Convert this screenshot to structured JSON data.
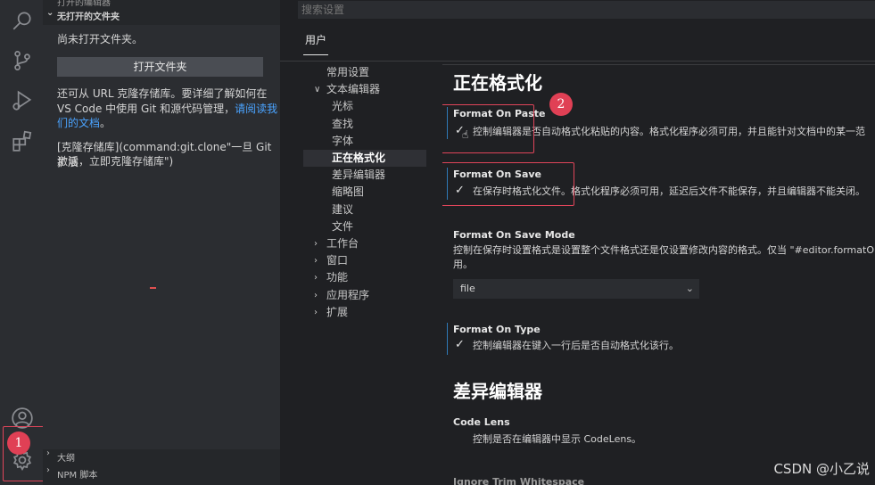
{
  "explorer": {
    "top_cut_label": "打开的编辑器",
    "section_title": "无打开的文件夹",
    "no_folder_text": "尚未打开文件夹。",
    "open_folder_button": "打开文件夹",
    "clone_text_1": "还可从 URL 克隆存储库。要详细了解如何在",
    "clone_text_2": "VS Code 中使用 Git 和源代码管理，",
    "clone_link_1": "请阅读我",
    "clone_link_2": "们的文档",
    "clone_text_end": "。",
    "clone_repo_1": "[克隆存储库](command:git.clone\"一旦 Git 扩展",
    "clone_repo_2": "激活，立即克隆存储库\")",
    "outline_label": "大纲",
    "npm_label": "NPM 脚本"
  },
  "settings": {
    "search_placeholder": "搜索设置",
    "tab_user": "用户",
    "toc": [
      {
        "label": "常用设置",
        "chev": ""
      },
      {
        "label": "文本编辑器",
        "chev": "∨"
      },
      {
        "label": "光标",
        "chev": ""
      },
      {
        "label": "查找",
        "chev": ""
      },
      {
        "label": "字体",
        "chev": ""
      },
      {
        "label": "正在格式化",
        "chev": "",
        "active": true
      },
      {
        "label": "差异编辑器",
        "chev": ""
      },
      {
        "label": "缩略图",
        "chev": ""
      },
      {
        "label": "建议",
        "chev": ""
      },
      {
        "label": "文件",
        "chev": ""
      },
      {
        "label": "工作台",
        "chev": ">"
      },
      {
        "label": "窗口",
        "chev": ">"
      },
      {
        "label": "功能",
        "chev": ">"
      },
      {
        "label": "应用程序",
        "chev": ">"
      },
      {
        "label": "扩展",
        "chev": ">"
      }
    ],
    "section_formatting": "正在格式化",
    "format_on_paste": {
      "title": "Format On Paste",
      "desc": "控制编辑器是否自动格式化粘贴的内容。格式化程序必须可用，并且能针对文档中的某一范",
      "checked": true
    },
    "format_on_save": {
      "title": "Format On Save",
      "desc": "在保存时格式化文件。格式化程序必须可用，延迟后文件不能保存，并且编辑器不能关闭。",
      "checked": true
    },
    "format_on_save_mode": {
      "title": "Format On Save Mode",
      "desc_1": "控制在保存时设置格式是设置整个文件格式还是仅设置修改内容的格式。仅当 \"#editor.formatOn",
      "desc_2": "用。",
      "value": "file"
    },
    "format_on_type": {
      "title": "Format On Type",
      "desc": "控制编辑器在键入一行后是否自动格式化该行。",
      "checked": true
    },
    "section_diff": "差异编辑器",
    "code_lens": {
      "title": "Code Lens",
      "desc": "控制是否在编辑器中显示 CodeLens。"
    },
    "next_cut_title": "Ignore Trim Whitespace"
  },
  "annotations": {
    "badge_1": "1",
    "badge_2": "2",
    "accent": "#e0455a"
  },
  "watermark": "CSDN @小乙说"
}
